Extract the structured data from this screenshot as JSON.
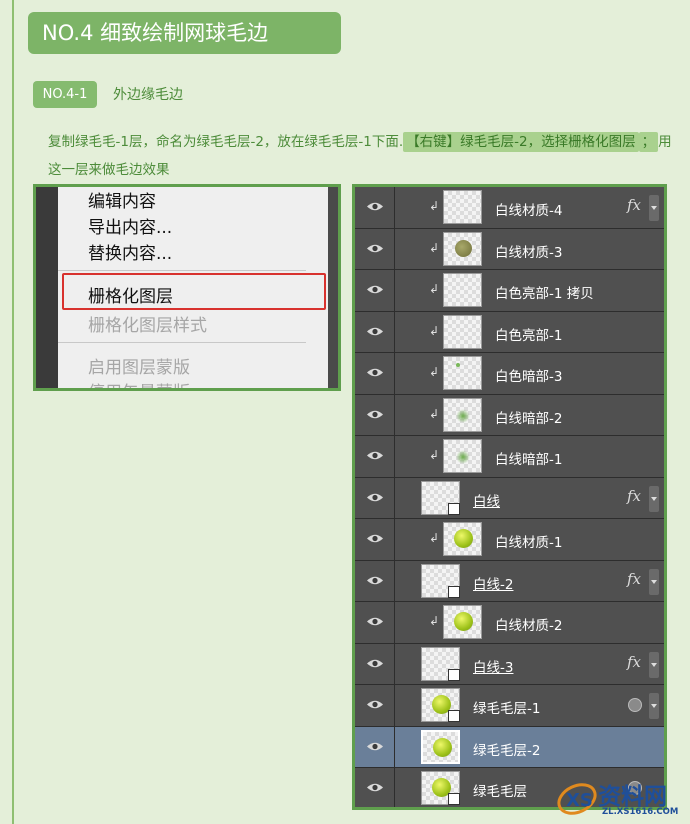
{
  "header": {
    "title": "NO.4  细致绘制网球毛边"
  },
  "section": {
    "badge": "NO.4-1",
    "title": "外边缘毛边"
  },
  "instruction": {
    "part1": "复制绿毛毛-1层，命名为绿毛毛层-2，放在绿毛毛层-1下面.",
    "highlight1": "【右键】绿毛毛层-2，选择栅格化图层",
    "separator": "；",
    "part2": "用这一层来做毛边效果"
  },
  "context_menu": {
    "items": [
      "编辑内容",
      "导出内容...",
      "替换内容...",
      "栅格化图层",
      "栅格化图层样式",
      "启用图层蒙版",
      "停用矢量蒙版"
    ],
    "highlighted_item": "栅格化图层",
    "highlight_color": "#d8322e"
  },
  "layers_panel": {
    "layers": [
      {
        "name": "白线材质-4",
        "clipped": true,
        "fx": "fx"
      },
      {
        "name": "白线材质-3",
        "clipped": true
      },
      {
        "name": "白色亮部-1 拷贝",
        "clipped": true
      },
      {
        "name": "白色亮部-1",
        "clipped": true
      },
      {
        "name": "白色暗部-3",
        "clipped": true
      },
      {
        "name": "白线暗部-2",
        "clipped": true
      },
      {
        "name": "白线暗部-1",
        "clipped": true
      },
      {
        "name": "白线",
        "clipped": false,
        "fx": "fx"
      },
      {
        "name": "白线材质-1",
        "clipped": true
      },
      {
        "name": "白线-2",
        "clipped": false,
        "fx": "fx"
      },
      {
        "name": "白线材质-2",
        "clipped": true
      },
      {
        "name": "白线-3",
        "clipped": false,
        "fx": "fx"
      },
      {
        "name": "绿毛毛层-1",
        "clipped": false
      },
      {
        "name": "绿毛毛层-2",
        "clipped": false,
        "selected": true
      },
      {
        "name": "绿毛毛层",
        "clipped": false
      }
    ],
    "selected_color": "#6a7f99",
    "fx_label": "fx"
  },
  "watermark": {
    "text": "资料网",
    "url": "ZL.XS1616.COM"
  },
  "colors": {
    "accent": "#7db467",
    "page_bg": "#e4efd9",
    "text": "#4d8c3a"
  }
}
